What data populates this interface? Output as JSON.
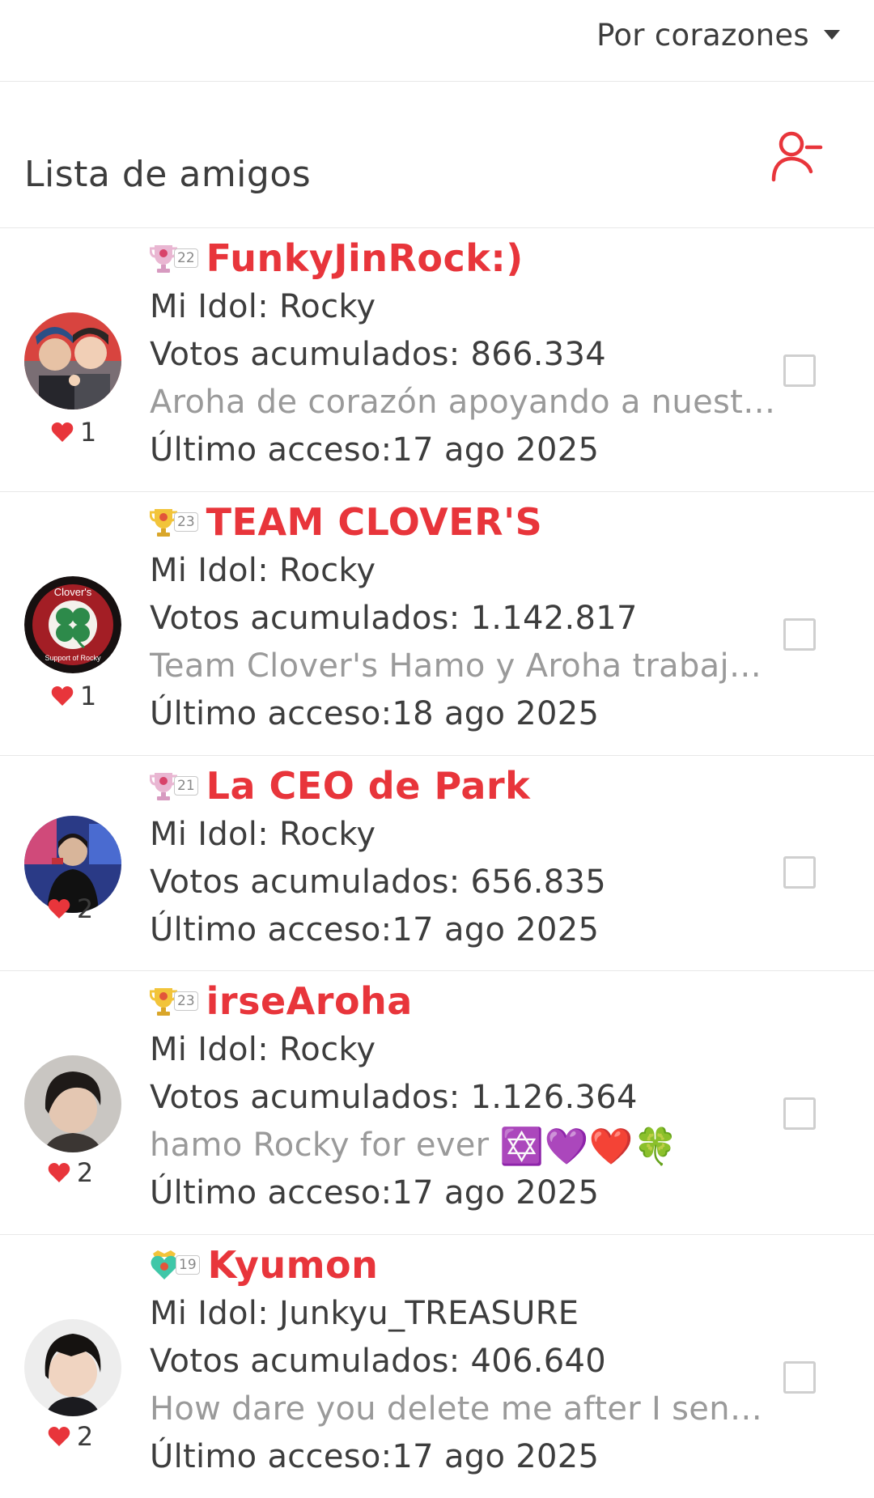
{
  "sort": {
    "label": "Por corazones"
  },
  "section": {
    "title": "Lista de amigos"
  },
  "friends": [
    {
      "level": "22",
      "name": "FunkyJinRock:)",
      "idol": "Mi Idol: Rocky",
      "votes": "Votos acumulados: 866.334",
      "bio": "Aroha de corazón apoyando a nuestro…",
      "last_access": "Último acceso:17 ago 2025",
      "hearts": "1"
    },
    {
      "level": "23",
      "name": "TEAM CLOVER'S",
      "idol": "Mi Idol: Rocky",
      "votes": "Votos acumulados: 1.142.817",
      "bio": "Team Clover's Hamo y Aroha trabaja…",
      "last_access": "Último acceso:18 ago 2025",
      "hearts": "1",
      "avatar_text_top": "Clover's",
      "avatar_text_bottom": "Support of Rocky"
    },
    {
      "level": "21",
      "name": "La CEO de Park",
      "idol": "Mi Idol: Rocky",
      "votes": "Votos acumulados: 656.835",
      "bio": "",
      "last_access": "Último acceso:17 ago 2025",
      "hearts": "2"
    },
    {
      "level": "23",
      "name": "irseAroha",
      "idol": "Mi Idol: Rocky",
      "votes": "Votos acumulados: 1.126.364",
      "bio": "hamo Rocky for ever",
      "bio_emojis": "✡️💜❤️🍀",
      "last_access": "Último acceso:17 ago 2025",
      "hearts": "2"
    },
    {
      "level": "19",
      "name": "Kyumon",
      "idol": "Mi Idol: Junkyu_TREASURE",
      "votes": "Votos acumulados: 406.640",
      "bio": "How dare you delete me after I send …",
      "last_access": "Último acceso:17 ago 2025",
      "hearts": "2"
    }
  ],
  "colors": {
    "accent": "#e8353b",
    "text": "#3d3d3d",
    "muted": "#9a9a9a",
    "divider": "#e8e8e8"
  }
}
